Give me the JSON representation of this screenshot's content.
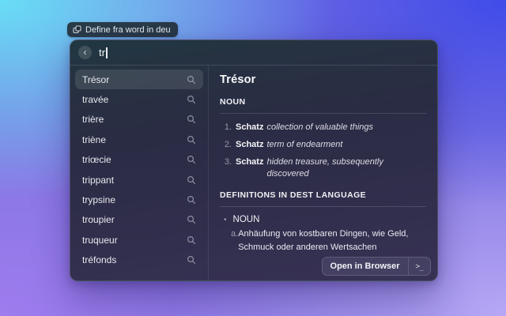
{
  "badge": {
    "label": "Define fra word in deu"
  },
  "icons": {
    "back": "‹",
    "bullet": "•"
  },
  "search": {
    "value": "tr"
  },
  "word_list": [
    {
      "label": "Trésor",
      "selected": true
    },
    {
      "label": "travée",
      "selected": false
    },
    {
      "label": "trière",
      "selected": false
    },
    {
      "label": "triène",
      "selected": false
    },
    {
      "label": "triœcie",
      "selected": false
    },
    {
      "label": "trippant",
      "selected": false
    },
    {
      "label": "trypsine",
      "selected": false
    },
    {
      "label": "troupier",
      "selected": false
    },
    {
      "label": "truqueur",
      "selected": false
    },
    {
      "label": "tréfonds",
      "selected": false
    }
  ],
  "detail": {
    "title": "Trésor",
    "pos_header": "NOUN",
    "noun_definitions": [
      {
        "number": "1.",
        "term": "Schatz",
        "definition": "collection of valuable things"
      },
      {
        "number": "2.",
        "term": "Schatz",
        "definition": "term of endearment"
      },
      {
        "number": "3.",
        "term": "Schatz",
        "definition": "hidden treasure, subsequently discovered"
      }
    ],
    "dest_header": "DEFINITIONS IN DEST LANGUAGE",
    "dest_groups": [
      {
        "pos": "NOUN",
        "entries": [
          {
            "prefix": "a.",
            "text": "Anhäufung von kostbaren Dingen, wie Geld, Schmuck oder anderen Wertsachen"
          }
        ]
      }
    ]
  },
  "footer": {
    "open_button": {
      "label": "Open in Browser",
      "shortcut_glyph": ">_"
    }
  },
  "colors": {
    "bg_top_left": "#68def6",
    "bg_top_right": "#404be8",
    "bg_bottom_left": "#9e7cee",
    "bg_bottom_right": "#b7a7f5",
    "panel_top": "#1f3842",
    "panel_bottom": "#373254",
    "selection": "rgba(255,255,255,0.11)"
  }
}
